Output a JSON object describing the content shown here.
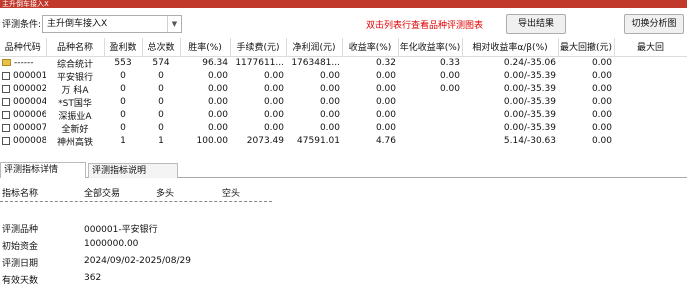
{
  "window": {
    "title": "主升倒车接入X"
  },
  "condition": {
    "label": "评测条件:",
    "value": "主升倒车接入X"
  },
  "notice": "双击列表行查看品种评测图表",
  "buttons": {
    "export": "导出结果",
    "switch": "切换分析图"
  },
  "table": {
    "headers": [
      "品种代码",
      "品种名称",
      "盈利数",
      "总次数",
      "胜率(%)",
      "手续费(元)",
      "净利润(元)",
      "收益率(%)",
      "年化收益率(%)",
      "相对收益率α/β(%)",
      "最大回撤(元)",
      "最大回"
    ],
    "rows": [
      [
        "------",
        "综合统计",
        "553",
        "574",
        "96.34",
        "1177611...",
        "1763481...",
        "0.32",
        "0.33",
        "0.24/-35.06",
        "0.00",
        ""
      ],
      [
        "000001",
        "平安银行",
        "0",
        "0",
        "0.00",
        "0.00",
        "0.00",
        "0.00",
        "0.00",
        "0.00/-35.39",
        "0.00",
        ""
      ],
      [
        "000002",
        "万 科A",
        "0",
        "0",
        "0.00",
        "0.00",
        "0.00",
        "0.00",
        "0.00",
        "0.00/-35.39",
        "0.00",
        ""
      ],
      [
        "000004",
        "*ST国华",
        "0",
        "0",
        "0.00",
        "0.00",
        "0.00",
        "0.00",
        "",
        "0.00/-35.39",
        "0.00",
        ""
      ],
      [
        "000006",
        "深振业A",
        "0",
        "0",
        "0.00",
        "0.00",
        "0.00",
        "0.00",
        "",
        "0.00/-35.39",
        "0.00",
        ""
      ],
      [
        "000007",
        "全新好",
        "0",
        "0",
        "0.00",
        "0.00",
        "0.00",
        "0.00",
        "",
        "0.00/-35.39",
        "0.00",
        ""
      ],
      [
        "000008",
        "神州高铁",
        "1",
        "1",
        "100.00",
        "2073.49",
        "47591.01",
        "4.76",
        "",
        "5.14/-30.63",
        "0.00",
        ""
      ]
    ]
  },
  "tabs": {
    "detail": "评测指标详情",
    "explain": "评测指标说明"
  },
  "detail": {
    "headers": {
      "name": "指标名称",
      "all": "全部交易",
      "long": "多头",
      "short": "空头"
    },
    "rows": [
      {
        "label": "评测品种",
        "value": "000001-平安银行"
      },
      {
        "label": "初始资金",
        "value": "1000000.00"
      },
      {
        "label": "评测日期",
        "value": "2024/09/02-2025/08/29"
      },
      {
        "label": "有效天数",
        "value": "362"
      }
    ]
  }
}
